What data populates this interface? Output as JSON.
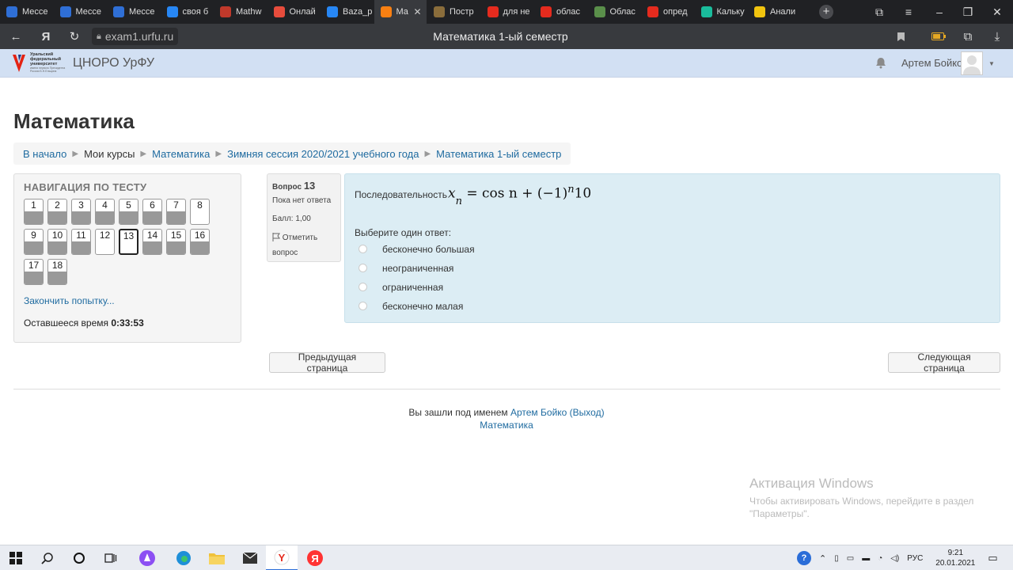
{
  "browser": {
    "tabs": [
      {
        "label": "Мессе",
        "icon": "messenger-icon",
        "color": "#2f6fd6"
      },
      {
        "label": "Мессе",
        "icon": "messenger-icon",
        "color": "#2f6fd6"
      },
      {
        "label": "Мессе",
        "icon": "messenger-icon",
        "color": "#2f6fd6"
      },
      {
        "label": "своя б",
        "icon": "vk-icon",
        "color": "#2787f5"
      },
      {
        "label": "Mathw",
        "icon": "mathway-icon",
        "color": "#c0392b"
      },
      {
        "label": "Онлай",
        "icon": "online-icon",
        "color": "#e74c3c"
      },
      {
        "label": "Baza_p",
        "icon": "vk-icon",
        "color": "#2787f5"
      },
      {
        "label": "Ма",
        "icon": "moodle-icon",
        "color": "#f98012"
      },
      {
        "label": "Постр",
        "icon": "graph-icon",
        "color": "#8a6d3b"
      },
      {
        "label": "для не",
        "icon": "yandex-icon",
        "color": "#e52b1e"
      },
      {
        "label": "облас",
        "icon": "yandex-icon",
        "color": "#e52b1e"
      },
      {
        "label": "Облас",
        "icon": "image-icon",
        "color": "#5a8f4a"
      },
      {
        "label": "опред",
        "icon": "yandex-icon",
        "color": "#e52b1e"
      },
      {
        "label": "Кальку",
        "icon": "calculator-icon",
        "color": "#1abc9c"
      },
      {
        "label": "Анали",
        "icon": "analysis-icon",
        "color": "#f1c40f"
      }
    ],
    "active_tab_index": 7,
    "url": "exam1.urfu.ru",
    "page_title": "Математика 1-ый семестр",
    "yandex_glyph": "Я"
  },
  "site": {
    "logo_text": "Уральский федеральный университет",
    "logo_subtext": "имени первого Президента России Б.Н.Ельцина",
    "name": "ЦНОРО УрФУ",
    "user": "Артем Бойко"
  },
  "page": {
    "heading": "Математика",
    "breadcrumb": [
      "В начало",
      "Мои курсы",
      "Математика",
      "Зимняя сессия 2020/2021 учебного года",
      "Математика 1-ый семестр"
    ]
  },
  "quiz_nav": {
    "title": "НАВИГАЦИЯ ПО ТЕСТУ",
    "questions": [
      {
        "n": "1",
        "answered": true
      },
      {
        "n": "2",
        "answered": true
      },
      {
        "n": "3",
        "answered": true
      },
      {
        "n": "4",
        "answered": true
      },
      {
        "n": "5",
        "answered": true
      },
      {
        "n": "6",
        "answered": true
      },
      {
        "n": "7",
        "answered": true
      },
      {
        "n": "8",
        "answered": false
      },
      {
        "n": "9",
        "answered": true
      },
      {
        "n": "10",
        "answered": true
      },
      {
        "n": "11",
        "answered": true
      },
      {
        "n": "12",
        "answered": false
      },
      {
        "n": "13",
        "answered": false,
        "current": true
      },
      {
        "n": "14",
        "answered": true
      },
      {
        "n": "15",
        "answered": true
      },
      {
        "n": "16",
        "answered": true
      },
      {
        "n": "17",
        "answered": true
      },
      {
        "n": "18",
        "answered": true
      }
    ],
    "finish_link": "Закончить попытку...",
    "time_label": "Оставшееся время",
    "time_value": "0:33:53"
  },
  "question": {
    "label": "Вопрос",
    "number": "13",
    "state": "Пока нет ответа",
    "grade": "Балл: 1,00",
    "flag_label": "Отметить вопрос",
    "text": "Последовательность",
    "formula": {
      "var": "x",
      "sub": "n",
      "rhs": "= cos n + (−1)",
      "sup": "n",
      "tail": "10"
    },
    "prompt": "Выберите один ответ:",
    "answers": [
      "бесконечно большая",
      "неограниченная",
      "ограниченная",
      "бесконечно малая"
    ]
  },
  "buttons": {
    "prev": "Предыдущая страница",
    "next": "Следующая страница"
  },
  "footer": {
    "logged_in": "Вы зашли под именем",
    "user": "Артем Бойко",
    "logout": "(Выход)",
    "course": "Математика"
  },
  "watermark": {
    "title": "Активация Windows",
    "line1": "Чтобы активировать Windows, перейдите в раздел",
    "line2": "\"Параметры\"."
  },
  "taskbar": {
    "lang": "РУС",
    "time": "9:21",
    "date": "20.01.2021"
  }
}
